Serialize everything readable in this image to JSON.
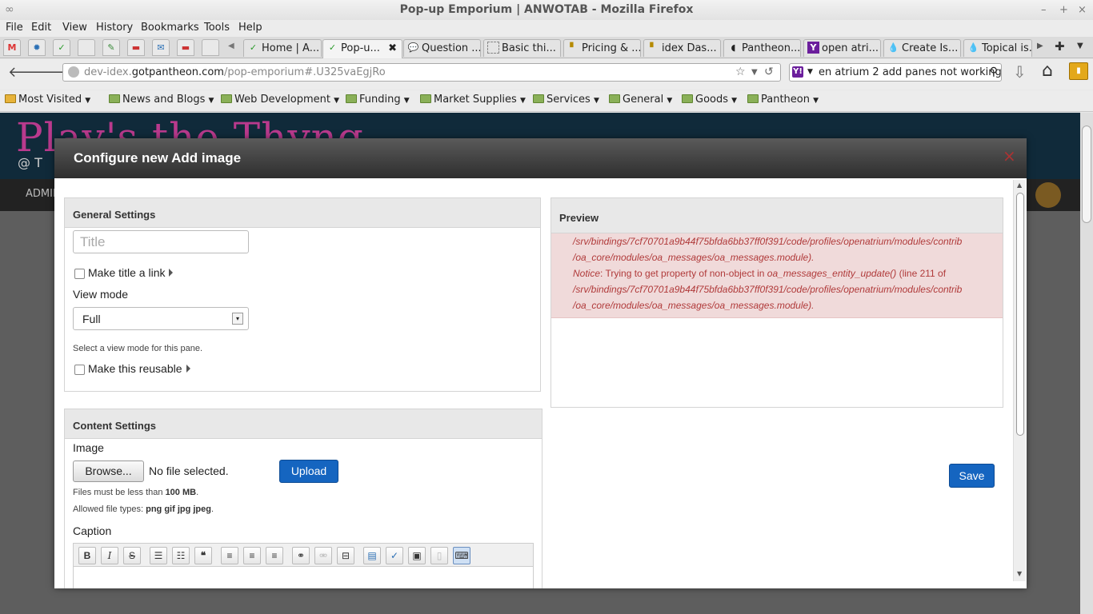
{
  "window": {
    "title": "Pop-up Emporium | ANWOTAB - Mozilla Firefox",
    "min": "–",
    "max": "+",
    "close": "×"
  },
  "menu": [
    "File",
    "Edit",
    "View",
    "History",
    "Bookmarks",
    "Tools",
    "Help"
  ],
  "tabs": [
    {
      "label": "Home | A...",
      "icon": "pantheon-icon"
    },
    {
      "label": "Pop-u...",
      "icon": "pantheon-icon",
      "active": true,
      "close": "✖"
    },
    {
      "label": "Question ...",
      "icon": "chat-icon"
    },
    {
      "label": "Basic thi...",
      "icon": "blank-page-icon"
    },
    {
      "label": "Pricing & ...",
      "icon": "pin-icon"
    },
    {
      "label": "idex Das...",
      "icon": "pin-icon"
    },
    {
      "label": "Pantheon...",
      "icon": "pantheon-icon"
    },
    {
      "label": "open atri...",
      "icon": "yahoo-icon",
      "glyph": "Y"
    },
    {
      "label": "Create Is...",
      "icon": "drupal-icon"
    },
    {
      "label": "Topical is...",
      "icon": "drupal-icon"
    }
  ],
  "pinned_tabs": [
    {
      "icon": "gmail-icon",
      "glyph": "M"
    },
    {
      "icon": "settings-icon",
      "glyph": "✹"
    },
    {
      "icon": "pantheon-icon",
      "glyph": "✓"
    },
    {
      "icon": "blank-page-icon",
      "glyph": ""
    },
    {
      "icon": "evernote-icon",
      "glyph": "✎"
    },
    {
      "icon": "calendar-icon",
      "glyph": "▬"
    },
    {
      "icon": "chat-icon",
      "glyph": "✉"
    },
    {
      "icon": "calendar-icon",
      "glyph": "▬"
    },
    {
      "icon": "blank-page-icon",
      "glyph": ""
    }
  ],
  "tabbar_controls": {
    "scroll_left": "◀",
    "scroll_right": "▶",
    "new_tab": "✚",
    "list_all": "▼"
  },
  "nav": {
    "back": "🡐",
    "forward": "🡒",
    "url_host_prefix": "dev-idex.",
    "url_host": "gotpantheon.com",
    "url_path": "/pop-emporium#.U325vaEgjRo",
    "bookmark_star": "☆",
    "dropdown": "▼",
    "reload": "↺",
    "search_value": "en atrium 2 add panes not working",
    "search_engine": "Y!",
    "search_dropdown": "▼",
    "search_icon": "⚲",
    "download": "⇩",
    "home": "⌂",
    "extension": "▮"
  },
  "bookmarks": [
    {
      "label": "Most Visited",
      "arrow": "▼"
    },
    {
      "label": "News and Blogs",
      "arrow": "▼"
    },
    {
      "label": "Web Development",
      "arrow": "▼"
    },
    {
      "label": "Funding",
      "arrow": "▼"
    },
    {
      "label": "Market Supplies",
      "arrow": "▼"
    },
    {
      "label": "Services",
      "arrow": "▼"
    },
    {
      "label": "General",
      "arrow": "▼"
    },
    {
      "label": "Goods",
      "arrow": "▼"
    },
    {
      "label": "Pantheon",
      "arrow": "▼"
    }
  ],
  "site": {
    "brand": "Play's the Thyng",
    "sub": "@ T",
    "admin": "ADMIN"
  },
  "modal": {
    "title": "Configure new Add image",
    "close": "×",
    "general": {
      "heading": "General Settings",
      "title_placeholder": "Title",
      "make_link": "Make title a link",
      "view_mode_label": "View mode",
      "view_mode_value": "Full",
      "view_mode_help": "Select a view mode for this pane.",
      "reusable": "Make this reusable",
      "select_arrow": "▾"
    },
    "preview": {
      "heading": "Preview",
      "error_lines": [
        {
          "text": "/srv/bindings/7cf70701a9b44f75bfda6bb37ff0f391/code/profiles/openatrium/modules/contrib"
        },
        {
          "text": "/oa_core/modules/oa_messages/oa_messages.module)."
        },
        {
          "notice": "Notice",
          "msg": ": Trying to get property of non-object in ",
          "fn": "oa_messages_entity_update()",
          "tail": " (line 211 of"
        },
        {
          "text": "/srv/bindings/7cf70701a9b44f75bfda6bb37ff0f391/code/profiles/openatrium/modules/contrib"
        },
        {
          "text": "/oa_core/modules/oa_messages/oa_messages.module)."
        }
      ]
    },
    "save": "Save",
    "content": {
      "heading": "Content Settings",
      "image_label": "Image",
      "browse": "Browse...",
      "no_file": "No file selected.",
      "upload": "Upload",
      "size_prefix": "Files must be less than ",
      "size_value": "100 MB",
      "size_suffix": ".",
      "types_prefix": "Allowed file types: ",
      "types_value": "png gif jpg jpeg",
      "types_suffix": ".",
      "caption_label": "Caption"
    },
    "toolbar": [
      {
        "icon": "bold-icon",
        "glyph": "B"
      },
      {
        "icon": "italic-icon",
        "glyph": "I"
      },
      {
        "icon": "strikethrough-icon",
        "glyph": "S"
      },
      {
        "icon": "bullet-list-icon",
        "glyph": "☰"
      },
      {
        "icon": "numbered-list-icon",
        "glyph": "☷"
      },
      {
        "icon": "blockquote-icon",
        "glyph": "❝"
      },
      {
        "icon": "align-left-icon",
        "glyph": "≡"
      },
      {
        "icon": "align-center-icon",
        "glyph": "≡"
      },
      {
        "icon": "align-right-icon",
        "glyph": "≡"
      },
      {
        "icon": "link-icon",
        "glyph": "⚭"
      },
      {
        "icon": "unlink-icon",
        "glyph": "⚮"
      },
      {
        "icon": "page-break-icon",
        "glyph": "⊟"
      },
      {
        "icon": "template-icon",
        "glyph": "▤"
      },
      {
        "icon": "spellcheck-icon",
        "glyph": "✓"
      },
      {
        "icon": "image-icon",
        "glyph": "▣"
      },
      {
        "icon": "source-icon",
        "glyph": "▯"
      },
      {
        "icon": "keyboard-icon",
        "glyph": "⌨"
      }
    ]
  }
}
